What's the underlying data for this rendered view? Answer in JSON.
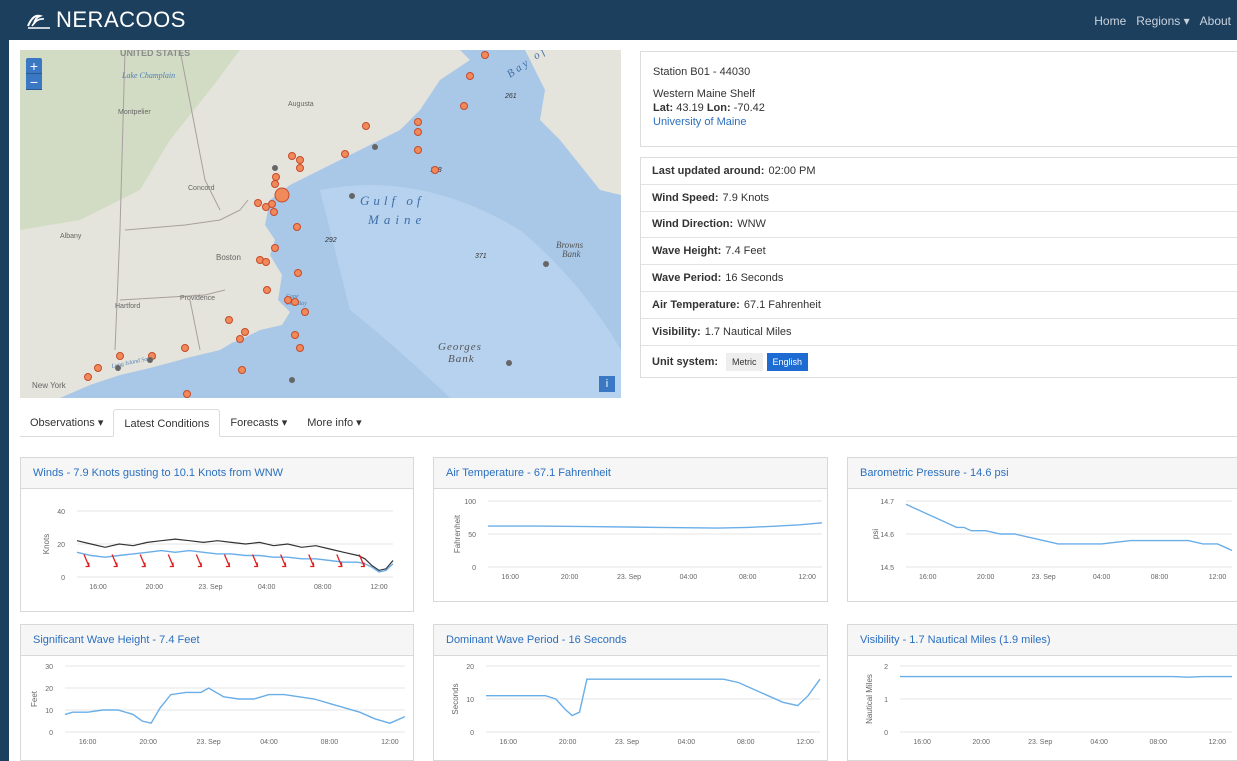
{
  "app": {
    "brand": "NERACOOS"
  },
  "nav": {
    "home": "Home",
    "regions": "Regions ▾",
    "about": "About"
  },
  "map": {
    "zoom_in": "+",
    "zoom_out": "−",
    "info": "i",
    "labels": {
      "united_states": "UNITED STATES",
      "lake_champlain": "Lake Champlain",
      "montpelier": "Montpelier",
      "augusta": "Augusta",
      "concord": "Concord",
      "albany": "Albany",
      "boston": "Boston",
      "providence": "Providence",
      "hartford": "Hartford",
      "new_york": "New York",
      "long_island_sound": "Long Island Sound",
      "gulf": "Gulf of",
      "maine": "Maine",
      "browns_bank_1": "Browns",
      "browns_bank_2": "Bank",
      "georges_bank_1": "Georges",
      "georges_bank_2": "Bank",
      "bay_of": "Bay of",
      "d292": "292",
      "d371": "371",
      "d261": "261",
      "d188": "188",
      "cape_cod_1": "Cape",
      "cape_cod_2": "Cod Bay"
    }
  },
  "station": {
    "title": "Station B01 - 44030",
    "name": "Western Maine Shelf",
    "lat_label": "Lat:",
    "lat": "43.19",
    "lon_label": "Lon:",
    "lon": "-70.42",
    "org": "University of Maine"
  },
  "conditions": {
    "rows": [
      {
        "label": "Last updated around:",
        "value": "02:00 PM"
      },
      {
        "label": "Wind Speed:",
        "value": "7.9 Knots"
      },
      {
        "label": "Wind Direction:",
        "value": "WNW"
      },
      {
        "label": "Wave Height:",
        "value": "7.4 Feet"
      },
      {
        "label": "Wave Period:",
        "value": "16 Seconds"
      },
      {
        "label": "Air Temperature:",
        "value": "67.1 Fahrenheit"
      },
      {
        "label": "Visibility:",
        "value": "1.7 Nautical Miles"
      }
    ],
    "unit_label": "Unit system:",
    "metric": "Metric",
    "english": "English"
  },
  "tabs": [
    {
      "label": "Observations ▾"
    },
    {
      "label": "Latest Conditions"
    },
    {
      "label": "Forecasts ▾"
    },
    {
      "label": "More info ▾"
    }
  ],
  "colors": {
    "navbar": "#1d3f5e",
    "link": "#2a6fbf",
    "series": "#6aaee8",
    "gust": "#333333",
    "arrow": "#e02020",
    "station": "#f08a5a"
  },
  "chart_data": [
    {
      "type": "line",
      "title": "Winds - 7.9 Knots gusting to 10.1 Knots from WNW",
      "ylabel": "Knots",
      "ylim": [
        0,
        40
      ],
      "yticks": [
        0,
        20,
        40
      ],
      "xlim": [
        14.5,
        37
      ],
      "xticks": [
        16,
        20,
        24,
        28,
        32,
        36
      ],
      "xticklabels": [
        "16:00",
        "20:00",
        "23. Sep",
        "04:00",
        "08:00",
        "12:00"
      ],
      "series": [
        {
          "role": "gust",
          "x": [
            14.5,
            15.5,
            16.5,
            17.5,
            18.5,
            19.5,
            20.5,
            21.5,
            22.5,
            23.5,
            24.5,
            25.5,
            26.5,
            27.5,
            28.5,
            29.5,
            30.5,
            31.5,
            32.5,
            33.5,
            34.5,
            35,
            35.5,
            36,
            36.5,
            37
          ],
          "y": [
            22,
            20,
            18,
            20,
            19,
            21,
            22,
            23,
            22,
            21,
            22,
            21,
            20,
            21,
            19,
            20,
            18,
            19,
            17,
            15,
            13,
            11,
            7,
            4,
            5,
            10
          ]
        },
        {
          "role": "speed",
          "x": [
            14.5,
            15.5,
            16.5,
            17.5,
            18.5,
            19.5,
            20.5,
            21.5,
            22.5,
            23.5,
            24.5,
            25.5,
            26.5,
            27.5,
            28.5,
            29.5,
            30.5,
            31.5,
            32.5,
            33.5,
            34.5,
            35,
            35.5,
            36,
            36.5,
            37
          ],
          "y": [
            15,
            13,
            12,
            13,
            14,
            15,
            16,
            15,
            16,
            15,
            14,
            14,
            13,
            13,
            12,
            12,
            11,
            11,
            10,
            9,
            9,
            8,
            6,
            3,
            4,
            8
          ]
        }
      ],
      "arrows": {
        "x": [
          15,
          17,
          19,
          21,
          23,
          25,
          27,
          29,
          31,
          33,
          34.6
        ]
      }
    },
    {
      "type": "line",
      "title": "Air Temperature - 67.1 Fahrenheit",
      "ylabel": "Fahrenheit",
      "ylim": [
        0,
        100
      ],
      "yticks": [
        0,
        50,
        100
      ],
      "xlim": [
        14.5,
        37
      ],
      "xticks": [
        16,
        20,
        24,
        28,
        32,
        36
      ],
      "xticklabels": [
        "16:00",
        "20:00",
        "23. Sep",
        "04:00",
        "08:00",
        "12:00"
      ],
      "series": [
        {
          "x": [
            14.5,
            18,
            22,
            26,
            30,
            32,
            34,
            35.5,
            37
          ],
          "y": [
            62,
            62,
            61,
            60,
            59,
            60,
            62,
            64,
            67
          ]
        }
      ]
    },
    {
      "type": "line",
      "title": "Barometric Pressure - 14.6 psi",
      "ylabel": "psi",
      "ylim": [
        14.5,
        14.7
      ],
      "yticks": [
        14.5,
        14.6,
        14.7
      ],
      "xlim": [
        14.5,
        37
      ],
      "xticks": [
        16,
        20,
        24,
        28,
        32,
        36
      ],
      "xticklabels": [
        "16:00",
        "20:00",
        "23. Sep",
        "04:00",
        "08:00",
        "12:00"
      ],
      "series": [
        {
          "x": [
            14.5,
            15,
            15.5,
            16,
            16.5,
            17,
            17.5,
            18,
            18.5,
            19,
            20,
            21,
            22,
            23,
            24,
            25,
            26,
            28,
            30,
            32,
            34,
            35,
            36,
            36.5,
            37
          ],
          "y": [
            14.69,
            14.68,
            14.67,
            14.66,
            14.65,
            14.64,
            14.63,
            14.62,
            14.62,
            14.61,
            14.61,
            14.6,
            14.6,
            14.59,
            14.58,
            14.57,
            14.57,
            14.57,
            14.58,
            14.58,
            14.58,
            14.57,
            14.57,
            14.56,
            14.55
          ]
        }
      ]
    },
    {
      "type": "line",
      "title": "Significant Wave Height - 7.4 Feet",
      "ylabel": "Feet",
      "ylim": [
        0,
        30
      ],
      "yticks": [
        0,
        10,
        20,
        30
      ],
      "xlim": [
        14.5,
        37
      ],
      "xticks": [
        16,
        20,
        24,
        28,
        32,
        36
      ],
      "xticklabels": [
        "16:00",
        "20:00",
        "23. Sep",
        "04:00",
        "08:00",
        "12:00"
      ],
      "series": [
        {
          "x": [
            14.5,
            15,
            16,
            17,
            18,
            19,
            19.6,
            20.2,
            20.8,
            21.5,
            22.5,
            23.5,
            24,
            25,
            26,
            27,
            28,
            29,
            30,
            31,
            32,
            33,
            34,
            35,
            36,
            37
          ],
          "y": [
            8,
            9,
            9,
            10,
            10,
            8,
            5,
            4,
            11,
            17,
            18,
            18,
            20,
            16,
            15,
            15,
            17,
            17,
            16,
            15,
            13,
            11,
            9,
            6,
            4,
            7
          ]
        }
      ]
    },
    {
      "type": "line",
      "title": "Dominant Wave Period - 16 Seconds",
      "ylabel": "Seconds",
      "ylim": [
        0,
        20
      ],
      "yticks": [
        0,
        10,
        20
      ],
      "xlim": [
        14.5,
        37
      ],
      "xticks": [
        16,
        20,
        24,
        28,
        32,
        36
      ],
      "xticklabels": [
        "16:00",
        "20:00",
        "23. Sep",
        "04:00",
        "08:00",
        "12:00"
      ],
      "series": [
        {
          "x": [
            14.5,
            18.5,
            19.2,
            19.8,
            20.3,
            20.8,
            21.3,
            24,
            28,
            30.5,
            31.5,
            32.5,
            33.5,
            34.5,
            35.5,
            36.2,
            37
          ],
          "y": [
            11,
            11,
            10,
            7,
            5,
            6,
            16,
            16,
            16,
            16,
            15,
            13,
            11,
            9,
            8,
            11,
            16
          ]
        }
      ]
    },
    {
      "type": "line",
      "title": "Visibility - 1.7 Nautical Miles (1.9 miles)",
      "ylabel": "Nautical Miles",
      "ylim": [
        0,
        2
      ],
      "yticks": [
        0,
        1,
        2
      ],
      "xlim": [
        14.5,
        37
      ],
      "xticks": [
        16,
        20,
        24,
        28,
        32,
        36
      ],
      "xticklabels": [
        "16:00",
        "20:00",
        "23. Sep",
        "04:00",
        "08:00",
        "12:00"
      ],
      "series": [
        {
          "x": [
            14.5,
            20,
            26,
            30,
            33,
            34,
            35,
            37
          ],
          "y": [
            1.68,
            1.68,
            1.68,
            1.68,
            1.68,
            1.66,
            1.68,
            1.68
          ]
        }
      ]
    }
  ]
}
